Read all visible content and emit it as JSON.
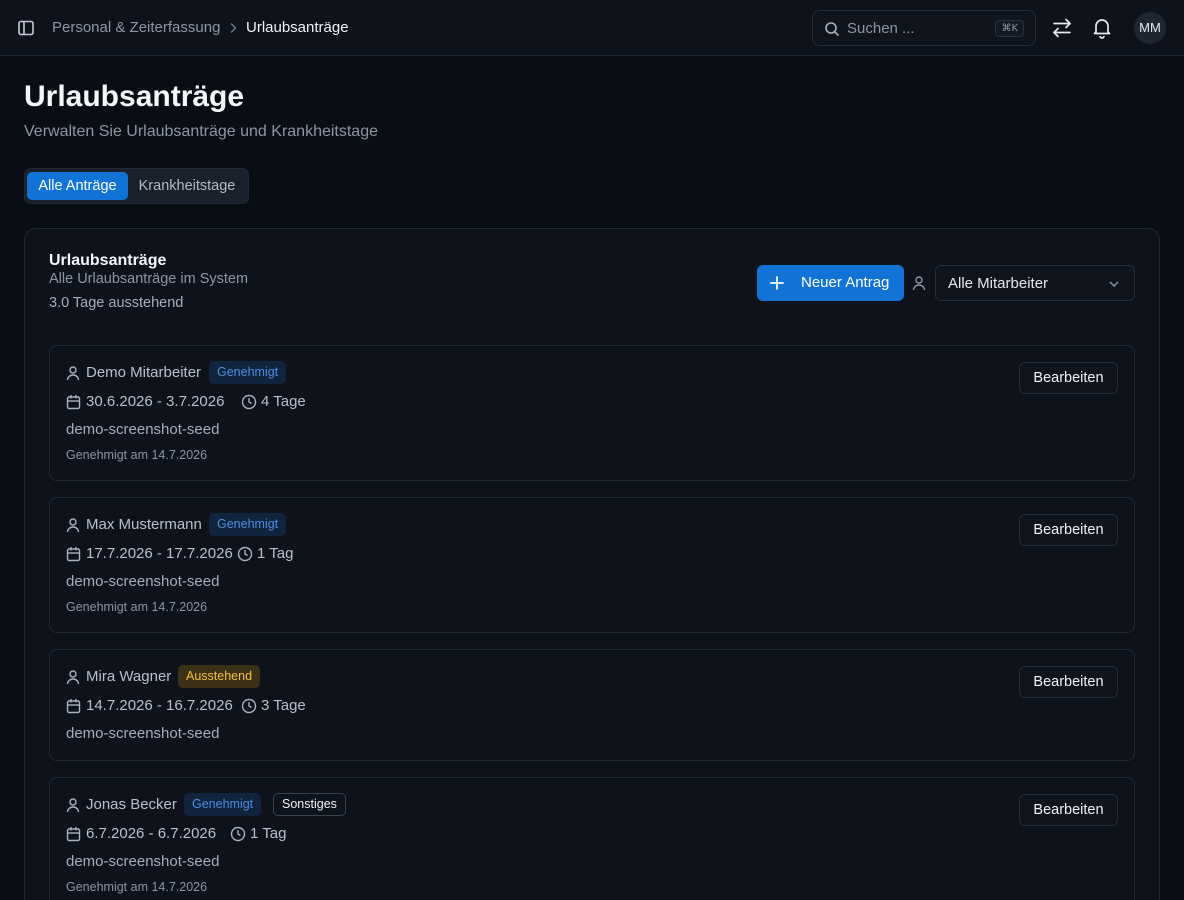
{
  "breadcrumb": {
    "parent": "Personal & Zeiterfassung",
    "current": "Urlaubsanträge"
  },
  "search": {
    "placeholder": "Suchen ...",
    "shortcut": "⌘K"
  },
  "user": {
    "initials": "MM"
  },
  "header": {
    "title": "Urlaubsanträge",
    "subtitle": "Verwalten Sie Urlaubsanträge und Krankheitstage"
  },
  "tabs": [
    {
      "label": "Alle Anträge",
      "active": true
    },
    {
      "label": "Krankheitstage",
      "active": false
    }
  ],
  "card": {
    "title": "Urlaubsanträge",
    "description": "Alle Urlaubsanträge im System",
    "pending": "3.0 Tage ausstehend",
    "new_button": "Neuer Antrag",
    "filter_value": "Alle Mitarbeiter"
  },
  "requests": [
    {
      "name": "Demo Mitarbeiter",
      "status": "Genehmigt",
      "dates": "30.6.2026 - 3.7.2026",
      "duration": "4 Tage",
      "reason": "demo-screenshot-seed",
      "approved": "Genehmigt am 14.7.2026",
      "edit": "Bearbeiten"
    },
    {
      "name": "Max Mustermann",
      "status": "Genehmigt",
      "dates": "17.7.2026 - 17.7.2026",
      "duration": "1 Tag",
      "reason": "demo-screenshot-seed",
      "approved": "Genehmigt am 14.7.2026",
      "edit": "Bearbeiten"
    },
    {
      "name": "Mira Wagner",
      "status": "Ausstehend",
      "dates": "14.7.2026 - 16.7.2026",
      "duration": "3 Tage",
      "reason": "demo-screenshot-seed",
      "edit": "Bearbeiten"
    },
    {
      "name": "Jonas Becker",
      "status": "Genehmigt",
      "type": "Sonstiges",
      "dates": "6.7.2026 - 6.7.2026",
      "duration": "1 Tag",
      "reason": "demo-screenshot-seed",
      "approved": "Genehmigt am 14.7.2026",
      "edit": "Bearbeiten"
    }
  ],
  "colors": {
    "accent": "#1273d6",
    "approved_text": "#4a8fe0",
    "pending_text": "#f2c23e",
    "background": "#090d14"
  }
}
